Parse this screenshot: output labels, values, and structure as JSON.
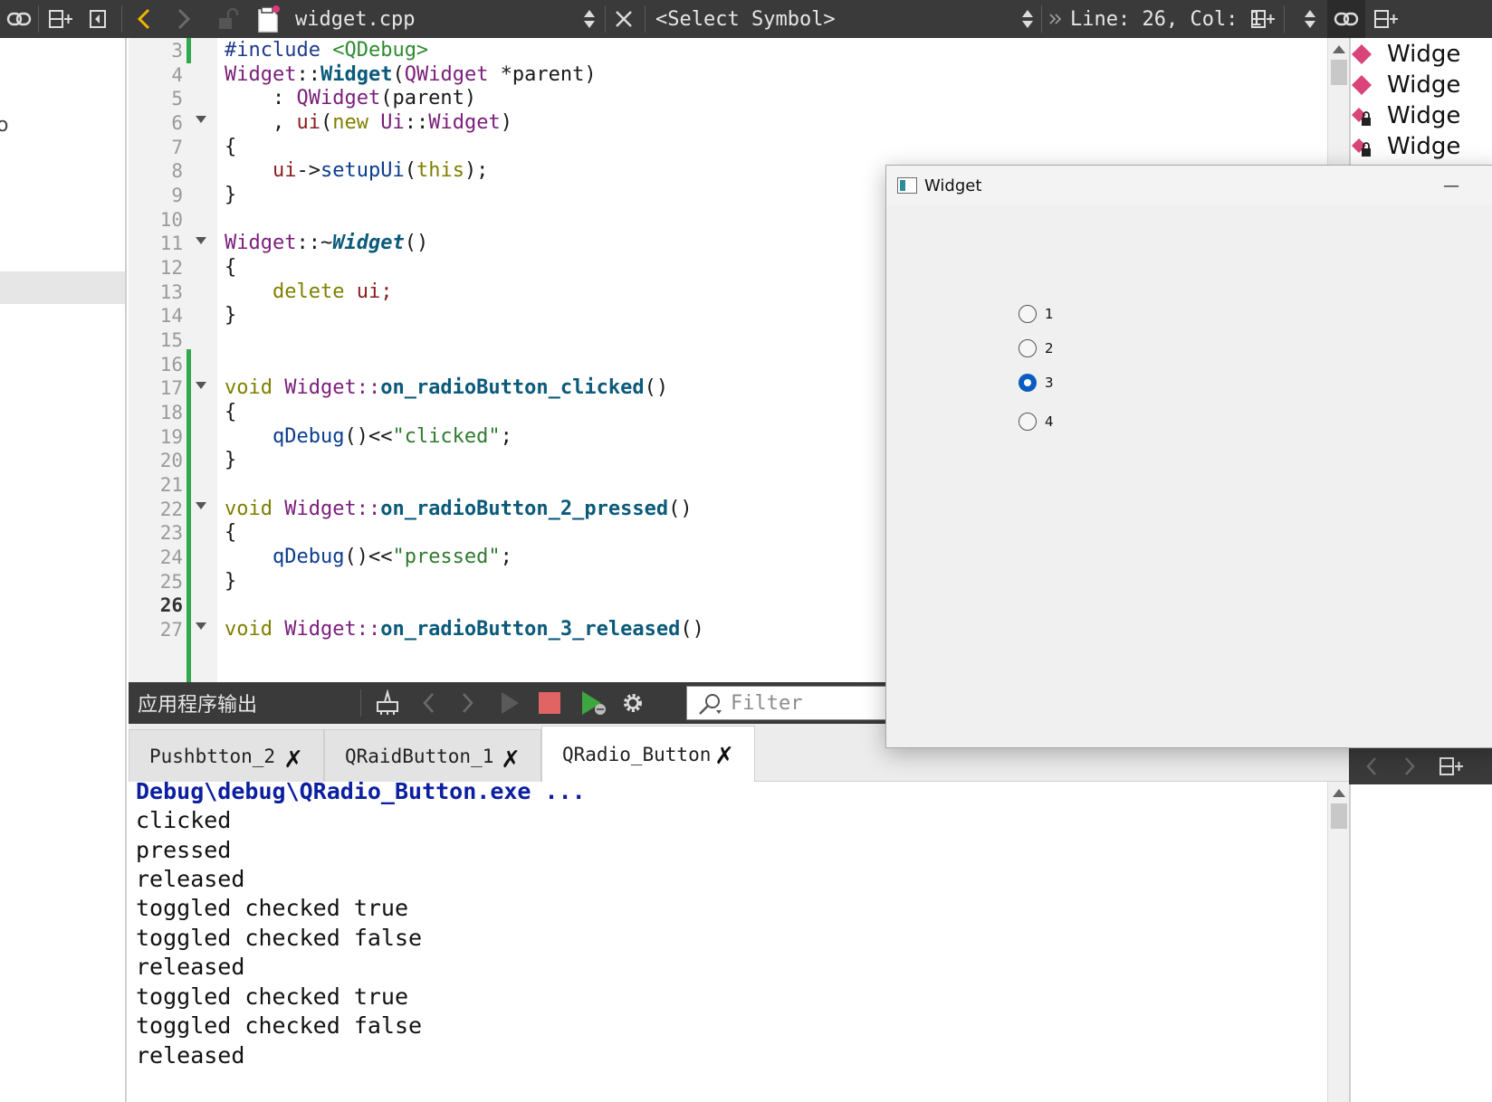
{
  "toolbar": {
    "file_name": "widget.cpp",
    "symbol": "<Select Symbol>",
    "position": "Line: 26, Col: 1"
  },
  "editor": {
    "current_line": 26,
    "line_numbers": [
      "3",
      "4",
      "5",
      "6",
      "7",
      "8",
      "9",
      "10",
      "11",
      "12",
      "13",
      "14",
      "15",
      "16",
      "17",
      "18",
      "19",
      "20",
      "21",
      "22",
      "23",
      "24",
      "25",
      "26",
      "27"
    ],
    "lines": {
      "l3": {
        "a": "#include ",
        "b": "<QDebug>"
      },
      "l4": {
        "a": "Widget",
        "b": "::",
        "c": "Widget",
        "d": "(",
        "e": "QWidget",
        "f": " *parent)"
      },
      "l5": {
        "a": "    : ",
        "b": "QWidget",
        "c": "(parent)"
      },
      "l6": {
        "a": "    , ",
        "b": "ui",
        "c": "(",
        "d": "new",
        "e": " Ui",
        "f": "::",
        "g": "Widget",
        "h": ")"
      },
      "l7": "{",
      "l8": {
        "a": "    ",
        "b": "ui",
        "c": "->",
        "d": "setupUi",
        "e": "(",
        "f": "this",
        "g": ");"
      },
      "l9": "}",
      "l11": {
        "a": "Widget",
        "b": "::~",
        "c": "Widget",
        "d": "()"
      },
      "l12": "{",
      "l13": {
        "a": "    ",
        "b": "delete",
        "c": " ui;"
      },
      "l14": "}",
      "l17": {
        "a": "void",
        "b": " Widget",
        "c": "::",
        "d": "on_radioButton_clicked",
        "e": "()"
      },
      "l18": "{",
      "l19": {
        "a": "    ",
        "b": "qDebug",
        "c": "()<<",
        "d": "\"clicked\"",
        "e": ";"
      },
      "l20": "}",
      "l22": {
        "a": "void",
        "b": " Widget",
        "c": "::",
        "d": "on_radioButton_2_pressed",
        "e": "()"
      },
      "l23": "{",
      "l24": {
        "a": "    ",
        "b": "qDebug",
        "c": "()<<",
        "d": "\"pressed\"",
        "e": ";"
      },
      "l25": "}",
      "l27": {
        "a": "void",
        "b": " Widget",
        "c": "::",
        "d": "on_radioButton_3_released",
        "e": "()"
      }
    }
  },
  "outline": {
    "items": [
      {
        "label": "Widge",
        "icon": "method-icon"
      },
      {
        "label": "Widge",
        "icon": "method-icon"
      },
      {
        "label": "Widge",
        "icon": "private-member-icon"
      },
      {
        "label": "Widge",
        "icon": "private-member-icon"
      }
    ]
  },
  "output": {
    "title": "应用程序输出",
    "filter_placeholder": "Filter",
    "tabs": [
      {
        "label": "Pushbtton_2",
        "active": false
      },
      {
        "label": "QRaidButton_1",
        "active": false
      },
      {
        "label": "QRadio_Button",
        "active": true
      }
    ],
    "lines": [
      "Debug\\debug\\QRadio_Button.exe ...",
      "clicked",
      "pressed",
      "released",
      "toggled checked true",
      "toggled checked false",
      "released",
      "toggled checked true",
      "toggled checked false",
      "released"
    ]
  },
  "widget_window": {
    "title": "Widget",
    "minimize": "—",
    "radios": [
      {
        "label": "1",
        "checked": false
      },
      {
        "label": "2",
        "checked": false
      },
      {
        "label": "3",
        "checked": true
      },
      {
        "label": "4",
        "checked": false
      }
    ]
  },
  "colors": {
    "toolbar_bg": "#3a3a3a",
    "accent_radio": "#0b5cc1",
    "output_header": "#0b1fa0",
    "change_marker": "#2fa84f"
  }
}
